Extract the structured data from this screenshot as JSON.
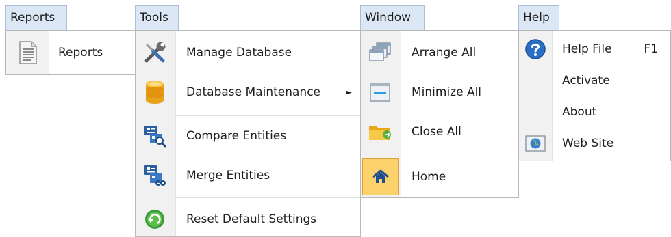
{
  "menus": {
    "reports": {
      "title": "Reports",
      "items": [
        {
          "label": "Reports"
        }
      ]
    },
    "tools": {
      "title": "Tools",
      "items": [
        {
          "label": "Manage Database"
        },
        {
          "label": "Database Maintenance",
          "submenu_arrow": "►"
        },
        {
          "label": "Compare Entities"
        },
        {
          "label": "Merge Entities"
        },
        {
          "label": "Reset Default Settings"
        }
      ]
    },
    "window": {
      "title": "Window",
      "items": [
        {
          "label": "Arrange All"
        },
        {
          "label": "Minimize All"
        },
        {
          "label": "Close All"
        },
        {
          "label": "Home"
        }
      ]
    },
    "help": {
      "title": "Help",
      "items": [
        {
          "label": "Help File",
          "shortcut": "F1"
        },
        {
          "label": "Activate"
        },
        {
          "label": "About"
        },
        {
          "label": "Web Site"
        }
      ]
    }
  },
  "icons": {
    "reports_item": "document-icon",
    "manage_database": "tools-wrench-screwdriver-icon",
    "database_maintenance": "database-icon",
    "compare_entities": "entity-compare-icon",
    "merge_entities": "entity-merge-icon",
    "reset_default_settings": "refresh-icon",
    "arrange_all": "cascade-windows-icon",
    "minimize_all": "minimize-windows-icon",
    "close_all": "folder-close-icon",
    "home": "home-icon",
    "help_file": "help-icon",
    "web_site": "globe-icon"
  },
  "colors": {
    "menu_title_bg": "#dbe7f4",
    "gutter_bg": "#f1f1f1",
    "highlight_bg": "#fbd26b",
    "accent_blue": "#2b6fc4"
  }
}
